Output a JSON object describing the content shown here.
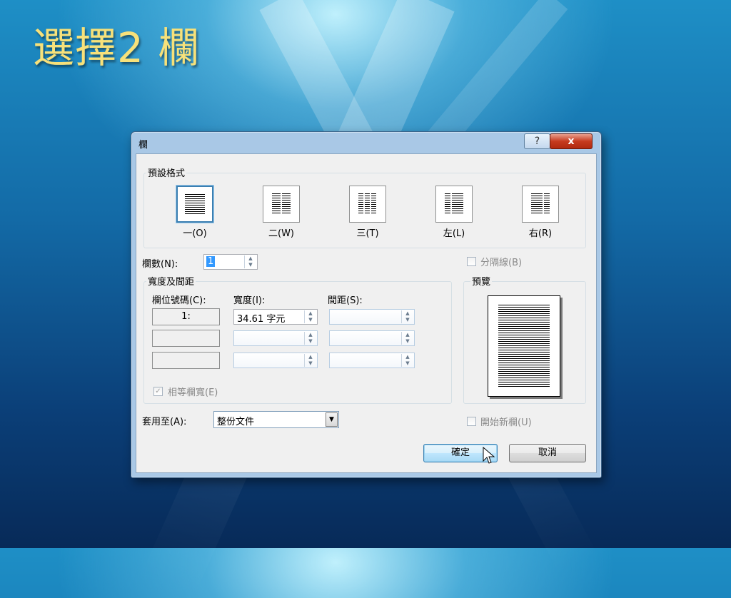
{
  "slide": {
    "title": "選擇2 欄"
  },
  "dialog": {
    "title": "欄",
    "help_label": "?",
    "close_label": "x",
    "presets_legend": "預設格式",
    "presets": [
      {
        "label": "一",
        "key": "(O)",
        "key_letter": "O",
        "columns": 1,
        "selected": true
      },
      {
        "label": "二",
        "key": "(W)",
        "key_letter": "W",
        "columns": 2,
        "selected": false
      },
      {
        "label": "三",
        "key": "(T)",
        "key_letter": "T",
        "columns": 3,
        "selected": false
      },
      {
        "label": "左",
        "key": "(L)",
        "key_letter": "L",
        "columns": "left",
        "selected": false
      },
      {
        "label": "右",
        "key": "(R)",
        "key_letter": "R",
        "columns": "right",
        "selected": false
      }
    ],
    "num_columns_label": "欄數(N):",
    "num_columns_value": "1",
    "line_between_label": "分隔線(B)",
    "width_spacing_legend": "寬度及間距",
    "col_number_header": "欄位號碼(C):",
    "width_header": "寬度(I):",
    "spacing_header": "間距(S):",
    "rows": [
      {
        "col": "1:",
        "width": "34.61 字元",
        "spacing": ""
      },
      {
        "col": "",
        "width": "",
        "spacing": ""
      },
      {
        "col": "",
        "width": "",
        "spacing": ""
      }
    ],
    "equal_width_label": "相等欄寬(E)",
    "preview_legend": "預覽",
    "apply_to_label": "套用至(A):",
    "apply_to_value": "整份文件",
    "new_column_label": "開始新欄(U)",
    "ok_label": "確定",
    "cancel_label": "取消"
  }
}
